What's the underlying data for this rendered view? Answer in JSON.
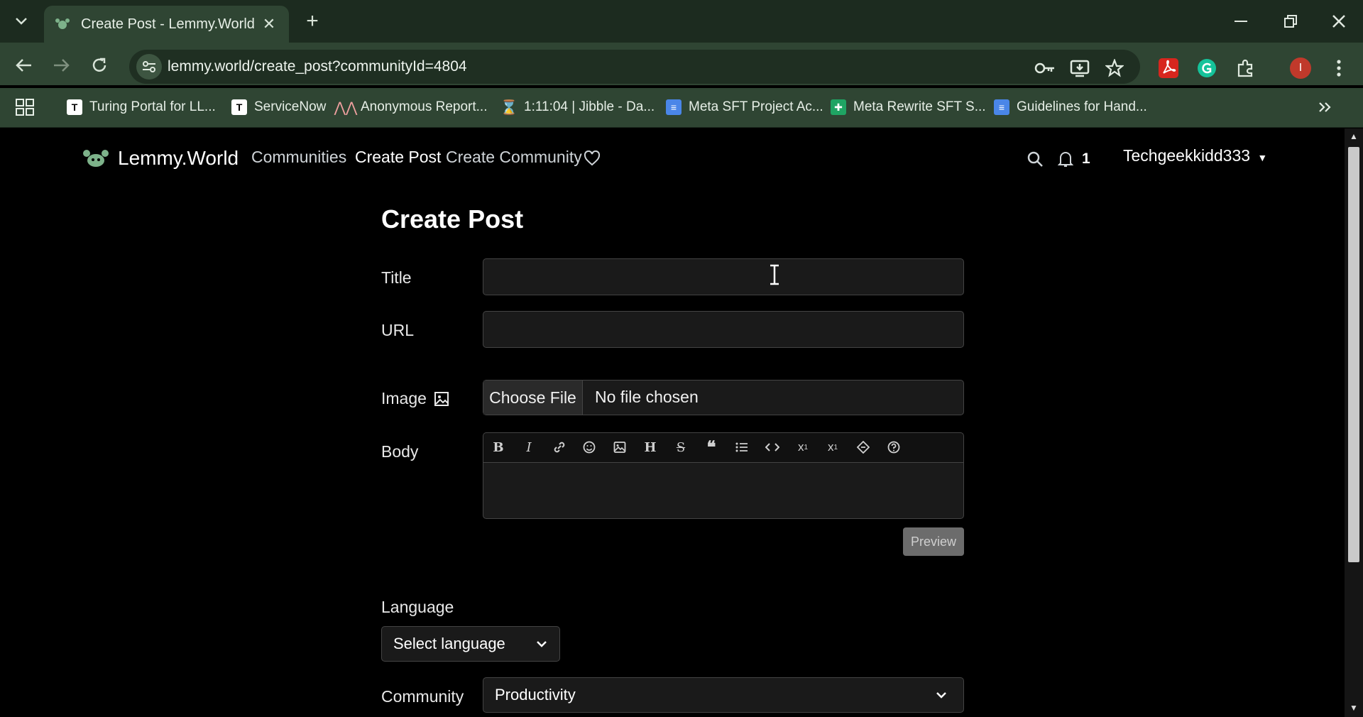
{
  "browser": {
    "tab_title": "Create Post - Lemmy.World",
    "tab_close": "✕",
    "new_tab": "+",
    "url": "lemmy.world/create_post?communityId=4804",
    "profile_initial": "I",
    "bookmarks": [
      {
        "label": "Turing Portal for LL..."
      },
      {
        "label": "ServiceNow"
      },
      {
        "label": "Anonymous Report..."
      },
      {
        "label": "1:11:04 | Jibble - Da..."
      },
      {
        "label": "Meta SFT Project Ac..."
      },
      {
        "label": "Meta Rewrite SFT S..."
      },
      {
        "label": "Guidelines for Hand..."
      }
    ]
  },
  "site": {
    "brand": "Lemmy.World",
    "nav": {
      "communities": "Communities",
      "create_post": "Create Post",
      "create_community": "Create Community"
    },
    "notification_count": "1",
    "username": "Techgeekkidd333"
  },
  "form": {
    "heading": "Create Post",
    "title_label": "Title",
    "title_value": "",
    "url_label": "URL",
    "url_value": "",
    "image_label": "Image",
    "choose_file": "Choose File",
    "file_status": "No file chosen",
    "body_label": "Body",
    "body_value": "",
    "preview": "Preview",
    "language_label": "Language",
    "language_value": "Select language",
    "community_label": "Community",
    "community_value": "Productivity"
  },
  "colors": {
    "chrome_dark": "#1c2b1f",
    "chrome": "#2f4533",
    "page_bg": "#000000",
    "field_bg": "#1a1a1a",
    "profile": "#c0392b"
  }
}
